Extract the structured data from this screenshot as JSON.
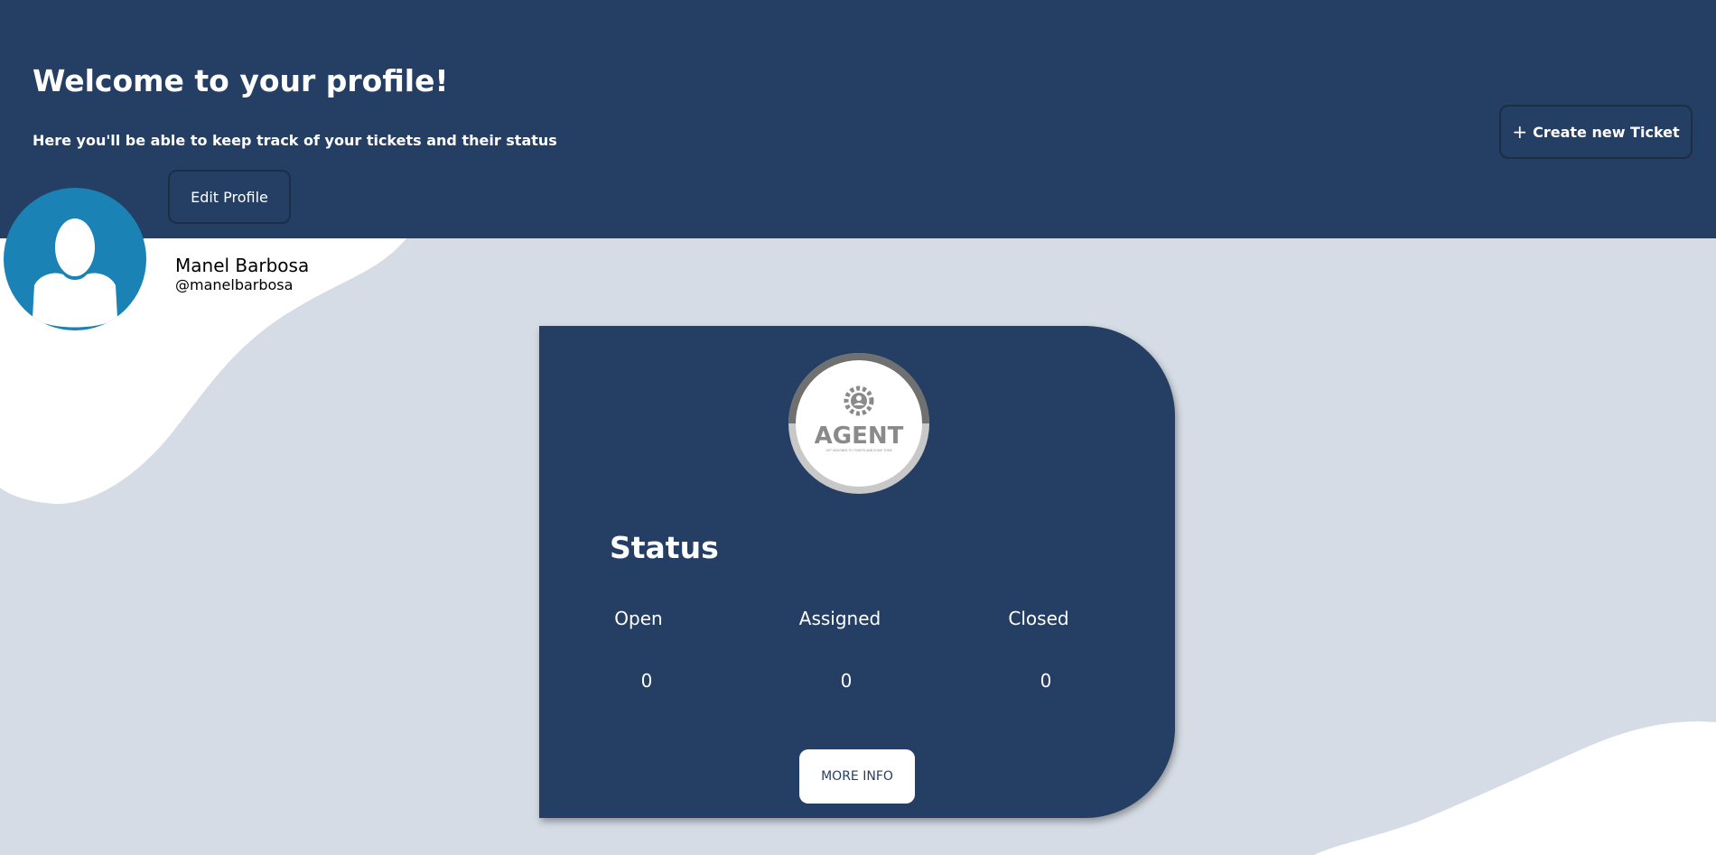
{
  "header": {
    "title": "Welcome to your profile!",
    "subtitle": "Here you'll be able to keep track of your tickets and their status",
    "create_ticket_label": "Create new Ticket",
    "edit_profile_label": "Edit Profile"
  },
  "profile": {
    "name": "Manel Barbosa",
    "username": "@manelbarbosa"
  },
  "status_card": {
    "badge_text": "AGENT",
    "badge_caption": "GET ASSIGNED TO TICKETS AND SOLVE THEM",
    "title": "Status",
    "columns": [
      {
        "label": "Open",
        "value": "0"
      },
      {
        "label": "Assigned",
        "value": "0"
      },
      {
        "label": "Closed",
        "value": "0"
      }
    ],
    "more_info_label": "MORE INFO"
  },
  "colors": {
    "header_bg": "#253f64",
    "page_bg": "#d6dce5",
    "avatar_bg": "#1a82b5",
    "accent_white": "#ffffff"
  },
  "icons": {
    "plus": "plus-icon",
    "avatar": "user-silhouette-icon",
    "badge": "gear-user-icon"
  }
}
